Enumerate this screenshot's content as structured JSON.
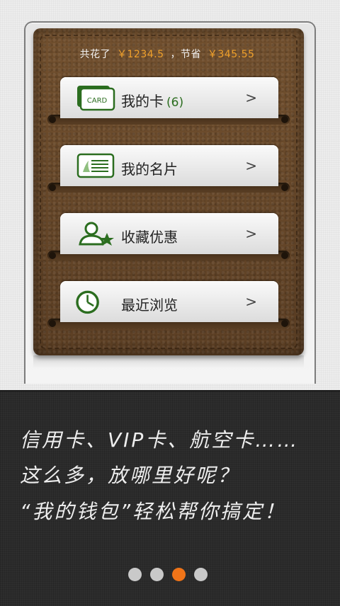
{
  "summary": {
    "spent_label": "共花了",
    "spent_amount": "￥1234.5",
    "saved_label": "，节省",
    "saved_amount": "￥345.55"
  },
  "menu": [
    {
      "label": "我的卡",
      "count": "(6)",
      "icon": "card-icon",
      "icon_text": "CARD"
    },
    {
      "label": "我的名片",
      "count": "",
      "icon": "business-card-icon"
    },
    {
      "label": "收藏优惠",
      "count": "",
      "icon": "favorite-user-star-icon"
    },
    {
      "label": "最近浏览",
      "count": "",
      "icon": "clock-icon"
    }
  ],
  "chevron": ">",
  "promo": {
    "line1": "信用卡、VIP卡、航空卡……",
    "line2": "这么多，放哪里好呢？",
    "line3": "“我的钱包”轻松帮你搞定！"
  },
  "pagination": {
    "total": 4,
    "active_index": 2
  },
  "colors": {
    "accent": "#f07418",
    "amount": "#f0a12b",
    "icon_green": "#2b6d1f",
    "leather": "#6b4a2b"
  }
}
